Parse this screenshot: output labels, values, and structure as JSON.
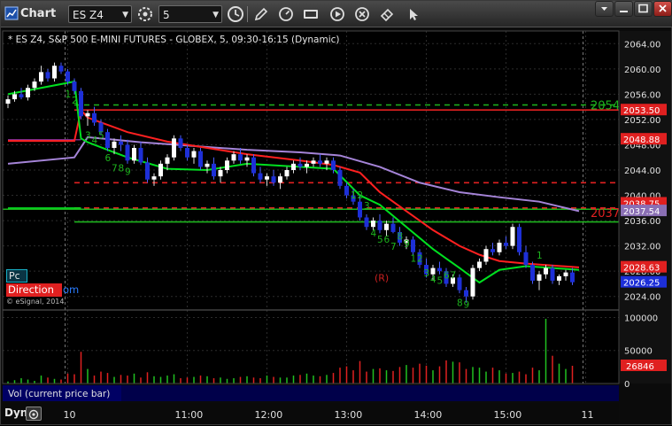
{
  "window": {
    "title": "Chart"
  },
  "toolbar": {
    "symbol": "ES Z4",
    "interval": "5",
    "icons": [
      "clock-icon",
      "pencil-icon",
      "speedometer-icon",
      "sec-icon",
      "play-icon",
      "x-icon",
      "eraser-icon",
      "cursor-icon"
    ]
  },
  "window_controls": [
    "menu",
    "minimize",
    "maximize",
    "close"
  ],
  "chart_header": "* ES Z4, S&P 500 E-MINI FUTURES - GLOBEX, 5, 09:30-16:15 (Dynamic)",
  "credit": "© eSignal, 2014",
  "panels": {
    "pc_label": "Pc",
    "direction_label": "Direction",
    "direction_suffix": "om"
  },
  "volume_panel": {
    "caption": "Vol (current price bar)"
  },
  "footer": {
    "dyn_label": "Dyn"
  },
  "colors": {
    "up": "#ffffff",
    "down": "#1d2fd8",
    "ema_fast": "#00e020",
    "ema_mid": "#ff2020",
    "ema_slow": "#a584d8",
    "count": "#1db41d",
    "accent_red": "#e52323"
  },
  "chart_data": [
    {
      "type": "candlestick",
      "title": "* ES Z4, S&P 500 E-MINI FUTURES - GLOBEX, 5, 09:30-16:15 (Dynamic)",
      "ylim": [
        2022,
        2066
      ],
      "y_ticks": [
        "2064.00",
        "2060.00",
        "2056.00",
        "2052.00",
        "2048.00",
        "2044.00",
        "2040.00",
        "2036.00",
        "2032.00",
        "2028.00",
        "2024.00"
      ],
      "x_ticks": [
        "10",
        "11:00",
        "12:00",
        "13:00",
        "14:00",
        "15:00",
        "11"
      ],
      "price_labels": [
        {
          "value": 2053.5,
          "text": "2053.50",
          "color": "#e02020"
        },
        {
          "value": 2048.88,
          "text": "2048.88",
          "color": "#e02020"
        },
        {
          "value": 2038.75,
          "text": "2038.75",
          "color": "#e02020"
        },
        {
          "value": 2037.54,
          "text": "2037.54",
          "color": "#8a6fb4"
        },
        {
          "value": 2028.63,
          "text": "2028.63",
          "color": "#e02020"
        },
        {
          "value": 2026.25,
          "text": "2026.25",
          "color": "#1d2fd8"
        }
      ],
      "level_labels": [
        {
          "value": 2054.3,
          "text": "2054",
          "color": "#1db41d"
        },
        {
          "value": 2037.3,
          "text": "2037",
          "color": "#e02020"
        }
      ],
      "levels": [
        {
          "value": 2054.3,
          "style": "dashed",
          "color": "#1db41d"
        },
        {
          "value": 2053.5,
          "style": "solid",
          "color": "#e02020"
        },
        {
          "value": 2042.0,
          "style": "dashed",
          "color": "#e02020"
        },
        {
          "value": 2038.0,
          "style": "dashed",
          "color": "#e02020"
        },
        {
          "value": 2037.8,
          "style": "solid",
          "color": "#1db41d"
        },
        {
          "value": 2035.8,
          "style": "solid",
          "color": "#1db41d"
        }
      ],
      "annotations": [
        {
          "text": "(R)",
          "value": 2027,
          "index": 56,
          "color": "#c82020"
        }
      ],
      "count_labels": [
        {
          "text": "1",
          "index": 9,
          "value": 2055.5
        },
        {
          "text": "2",
          "index": 10,
          "value": 2054.5
        },
        {
          "text": "3",
          "index": 12,
          "value": 2049
        },
        {
          "text": "4",
          "index": 13,
          "value": 2048.2
        },
        {
          "text": "5",
          "index": 14,
          "value": 2049
        },
        {
          "text": "6",
          "index": 15,
          "value": 2045.4
        },
        {
          "text": "7",
          "index": 16,
          "value": 2043.8
        },
        {
          "text": "8",
          "index": 17,
          "value": 2043.8
        },
        {
          "text": "9",
          "index": 18,
          "value": 2043.2
        },
        {
          "text": "1",
          "index": 52,
          "value": 2039.5
        },
        {
          "text": "2",
          "index": 53,
          "value": 2039.5
        },
        {
          "text": "3",
          "index": 54,
          "value": 2037.8
        },
        {
          "text": "4",
          "index": 55,
          "value": 2033.5
        },
        {
          "text": "5",
          "index": 56,
          "value": 2032.5
        },
        {
          "text": "6",
          "index": 57,
          "value": 2032.5
        },
        {
          "text": "7",
          "index": 58,
          "value": 2031.4
        },
        {
          "text": "8",
          "index": 59,
          "value": 2033
        },
        {
          "text": "9",
          "index": 60,
          "value": 2031.8
        },
        {
          "text": "1",
          "index": 61,
          "value": 2029.5
        },
        {
          "text": "2",
          "index": 62,
          "value": 2029.5
        },
        {
          "text": "3",
          "index": 63,
          "value": 2027.2
        },
        {
          "text": "4",
          "index": 64,
          "value": 2026.2
        },
        {
          "text": "5",
          "index": 65,
          "value": 2026
        },
        {
          "text": "6",
          "index": 66,
          "value": 2026.8
        },
        {
          "text": "7",
          "index": 67,
          "value": 2026.8
        },
        {
          "text": "8",
          "index": 68,
          "value": 2022.5
        },
        {
          "text": "9",
          "index": 69,
          "value": 2022.2
        },
        {
          "text": "1",
          "index": 80,
          "value": 2030
        }
      ],
      "ohlc": [
        [
          2054.5,
          2055.8,
          2053.8,
          2055.2
        ],
        [
          2055.2,
          2056.5,
          2054.8,
          2056
        ],
        [
          2056,
          2057,
          2055.2,
          2055.5
        ],
        [
          2055.5,
          2057.5,
          2055,
          2057
        ],
        [
          2057,
          2058.5,
          2056.5,
          2058
        ],
        [
          2058,
          2060.5,
          2057.5,
          2059.5
        ],
        [
          2059.5,
          2060,
          2058,
          2058.5
        ],
        [
          2058.5,
          2061,
          2058,
          2060.5
        ],
        [
          2060.5,
          2061,
          2059.2,
          2059.6
        ],
        [
          2059.6,
          2060,
          2057.5,
          2058
        ],
        [
          2058,
          2058.5,
          2056,
          2056.5
        ],
        [
          2056.5,
          2057,
          2052,
          2052.5
        ],
        [
          2052.5,
          2053.5,
          2051,
          2053
        ],
        [
          2053,
          2054,
          2051,
          2051.5
        ],
        [
          2051.5,
          2052,
          2049.5,
          2050
        ],
        [
          2050,
          2050.5,
          2047,
          2047.5
        ],
        [
          2047.5,
          2049,
          2046.5,
          2048.5
        ],
        [
          2048.5,
          2049.5,
          2047,
          2048
        ],
        [
          2048,
          2048.8,
          2045,
          2045.5
        ],
        [
          2045.5,
          2048,
          2045,
          2047.5
        ],
        [
          2047.5,
          2048.5,
          2044.8,
          2045.2
        ],
        [
          2045.2,
          2046,
          2042,
          2042.5
        ],
        [
          2042.5,
          2043.5,
          2041.5,
          2043
        ],
        [
          2043,
          2045.5,
          2042.5,
          2045
        ],
        [
          2045,
          2046.5,
          2044,
          2046
        ],
        [
          2046,
          2049.5,
          2045.5,
          2049
        ],
        [
          2049,
          2049.5,
          2047,
          2047.5
        ],
        [
          2047.5,
          2048,
          2045.5,
          2046
        ],
        [
          2046,
          2047.5,
          2045,
          2047
        ],
        [
          2047,
          2047.5,
          2044,
          2044.5
        ],
        [
          2044.5,
          2045.5,
          2043.5,
          2045
        ],
        [
          2045,
          2046,
          2042.5,
          2043
        ],
        [
          2043,
          2044.5,
          2042,
          2044
        ],
        [
          2044,
          2046,
          2043.5,
          2045.5
        ],
        [
          2045.5,
          2047,
          2045,
          2046.5
        ],
        [
          2046.5,
          2047.5,
          2045,
          2045.5
        ],
        [
          2045.5,
          2046.5,
          2044.5,
          2046
        ],
        [
          2046,
          2046.5,
          2043,
          2043.5
        ],
        [
          2043.5,
          2044.5,
          2042,
          2042.5
        ],
        [
          2042.5,
          2043.5,
          2041.5,
          2043
        ],
        [
          2043,
          2044,
          2041.5,
          2042
        ],
        [
          2042,
          2043.5,
          2041,
          2043
        ],
        [
          2043,
          2044.5,
          2042.5,
          2044
        ],
        [
          2044,
          2045.5,
          2043.5,
          2045
        ],
        [
          2045,
          2046,
          2044,
          2044.5
        ],
        [
          2044.5,
          2045.5,
          2043.5,
          2045
        ],
        [
          2045,
          2046,
          2044.5,
          2045.5
        ],
        [
          2045.5,
          2046.5,
          2044.5,
          2045
        ],
        [
          2045,
          2046,
          2044,
          2045.5
        ],
        [
          2045.5,
          2046,
          2043.5,
          2044
        ],
        [
          2044,
          2044.5,
          2041,
          2041.5
        ],
        [
          2041.5,
          2042,
          2039.5,
          2040
        ],
        [
          2040,
          2041,
          2038.5,
          2039
        ],
        [
          2039,
          2040,
          2036,
          2036.5
        ],
        [
          2036.5,
          2037,
          2034.5,
          2035
        ],
        [
          2035,
          2036.5,
          2034.5,
          2036
        ],
        [
          2036,
          2037,
          2034,
          2034.5
        ],
        [
          2034.5,
          2036,
          2033.5,
          2035.5
        ],
        [
          2035.5,
          2036.5,
          2034,
          2034.2
        ],
        [
          2034.2,
          2035,
          2032,
          2032.5
        ],
        [
          2032.5,
          2033.5,
          2031.5,
          2033
        ],
        [
          2033,
          2033.5,
          2030.5,
          2031
        ],
        [
          2031,
          2031.5,
          2028.5,
          2029
        ],
        [
          2029,
          2030,
          2027,
          2027.5
        ],
        [
          2027.5,
          2029,
          2026.5,
          2028.5
        ],
        [
          2028.5,
          2029.5,
          2027.5,
          2028
        ],
        [
          2028,
          2028.5,
          2025.5,
          2026
        ],
        [
          2026,
          2027.5,
          2025.5,
          2027
        ],
        [
          2027,
          2027.5,
          2024.5,
          2025
        ],
        [
          2025,
          2025.5,
          2023,
          2024
        ],
        [
          2024,
          2029,
          2023.5,
          2028.5
        ],
        [
          2028.5,
          2030,
          2028,
          2029.5
        ],
        [
          2029.5,
          2032,
          2029,
          2031.5
        ],
        [
          2031.5,
          2032.5,
          2030.5,
          2031
        ],
        [
          2031,
          2033,
          2030.5,
          2032.5
        ],
        [
          2032.5,
          2033.5,
          2031.5,
          2032
        ],
        [
          2032,
          2035.5,
          2031.5,
          2035
        ],
        [
          2035,
          2035.5,
          2030.5,
          2031
        ],
        [
          2031,
          2032,
          2028.5,
          2029
        ],
        [
          2029,
          2029.5,
          2026,
          2026.5
        ],
        [
          2026.5,
          2028,
          2025,
          2027.5
        ],
        [
          2027.5,
          2029,
          2026.8,
          2028.5
        ],
        [
          2028.5,
          2029,
          2026,
          2026.5
        ],
        [
          2026.5,
          2027.5,
          2025.8,
          2027.2
        ],
        [
          2027.2,
          2028.2,
          2026.5,
          2027.8
        ],
        [
          2027.8,
          2028.5,
          2025.8,
          2026.25
        ]
      ],
      "ema_fast": [
        [
          0,
          2056
        ],
        [
          10,
          2058
        ],
        [
          11,
          2049
        ],
        [
          12,
          2048.4
        ],
        [
          18,
          2046
        ],
        [
          24,
          2044.2
        ],
        [
          30,
          2044
        ],
        [
          36,
          2045
        ],
        [
          44,
          2044.5
        ],
        [
          49,
          2044.2
        ],
        [
          53,
          2040
        ],
        [
          56,
          2038.5
        ],
        [
          60,
          2035
        ],
        [
          64,
          2031.5
        ],
        [
          68,
          2028.5
        ],
        [
          71,
          2026.2
        ],
        [
          74,
          2028.2
        ],
        [
          78,
          2028.8
        ],
        [
          86,
          2028.2
        ]
      ],
      "ema_mid": [
        [
          0,
          2048.6
        ],
        [
          10,
          2048.6
        ],
        [
          11,
          2053.5
        ],
        [
          12,
          2052.3
        ],
        [
          18,
          2050
        ],
        [
          24,
          2048.5
        ],
        [
          30,
          2047.5
        ],
        [
          36,
          2046.5
        ],
        [
          44,
          2045.5
        ],
        [
          49,
          2044.8
        ],
        [
          53,
          2043.6
        ],
        [
          56,
          2040.5
        ],
        [
          60,
          2037.5
        ],
        [
          64,
          2034.5
        ],
        [
          68,
          2032
        ],
        [
          71,
          2030.6
        ],
        [
          74,
          2029.6
        ],
        [
          78,
          2029.2
        ],
        [
          86,
          2028.6
        ]
      ],
      "ema_slow": [
        [
          0,
          2045
        ],
        [
          10,
          2046
        ],
        [
          12,
          2049.2
        ],
        [
          20,
          2048.4
        ],
        [
          28,
          2047.8
        ],
        [
          36,
          2047.2
        ],
        [
          44,
          2046.8
        ],
        [
          50,
          2046.3
        ],
        [
          56,
          2044.5
        ],
        [
          62,
          2042
        ],
        [
          68,
          2040.5
        ],
        [
          74,
          2039.7
        ],
        [
          80,
          2039
        ],
        [
          86,
          2037.5
        ]
      ],
      "purple_base": [
        [
          0,
          2048.8
        ],
        [
          11,
          2048.8
        ]
      ],
      "green_pre": [
        [
          0,
          2038
        ],
        [
          11,
          2038
        ]
      ]
    },
    {
      "type": "bar",
      "title": "Vol (current price bar)",
      "ylim": [
        0,
        110000
      ],
      "y_ticks": [
        "100000",
        "50000",
        "0"
      ],
      "last_value_label": "26846",
      "values": [
        3000,
        5000,
        8000,
        6000,
        4000,
        12000,
        9000,
        7000,
        6000,
        15000,
        14000,
        48000,
        22000,
        12000,
        18000,
        16000,
        10000,
        13000,
        12000,
        15000,
        9000,
        17000,
        11000,
        10000,
        12000,
        14000,
        8000,
        9000,
        10000,
        12000,
        11000,
        8000,
        9000,
        7000,
        8000,
        10000,
        11000,
        9000,
        8000,
        12000,
        10000,
        9000,
        9000,
        12000,
        13000,
        15000,
        12000,
        11000,
        13000,
        16000,
        24000,
        26000,
        20000,
        34000,
        18000,
        22000,
        23000,
        20000,
        19000,
        25000,
        28000,
        24000,
        30000,
        27000,
        20000,
        26000,
        35000,
        33000,
        32000,
        22000,
        25000,
        24000,
        18000,
        24000,
        20000,
        15000,
        16000,
        18000,
        14000,
        24000,
        20000,
        98000,
        42000,
        30000,
        22000,
        26846
      ],
      "up": [
        true,
        true,
        true,
        true,
        true,
        true,
        false,
        true,
        false,
        false,
        false,
        false,
        true,
        false,
        false,
        false,
        true,
        false,
        false,
        true,
        false,
        false,
        true,
        true,
        true,
        true,
        false,
        false,
        true,
        false,
        true,
        false,
        true,
        true,
        true,
        false,
        true,
        false,
        false,
        true,
        false,
        true,
        true,
        true,
        false,
        true,
        true,
        false,
        true,
        false,
        false,
        false,
        false,
        false,
        false,
        true,
        false,
        true,
        false,
        false,
        true,
        false,
        false,
        false,
        true,
        false,
        false,
        true,
        false,
        false,
        true,
        true,
        true,
        false,
        true,
        false,
        true,
        false,
        false,
        false,
        true,
        true,
        false,
        true,
        true,
        false
      ]
    }
  ]
}
